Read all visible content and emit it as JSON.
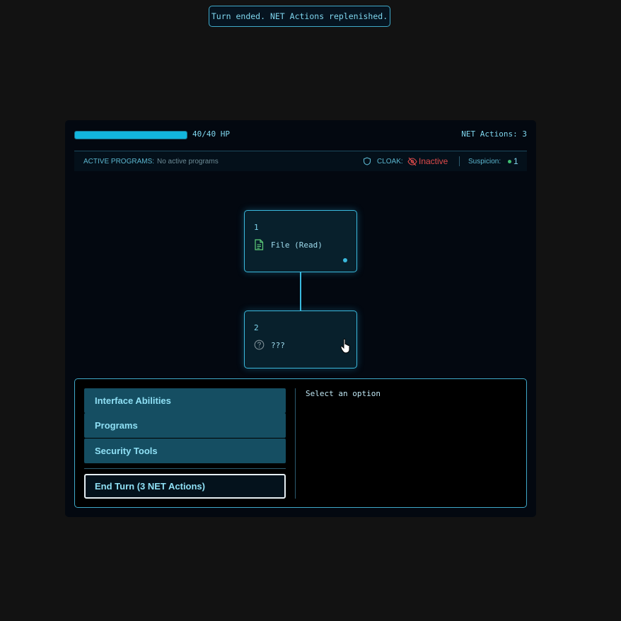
{
  "notification": {
    "text": "Turn ended. NET Actions replenished."
  },
  "header": {
    "hp": {
      "current": 40,
      "max": 40,
      "text": "40/40 HP",
      "fill_fraction": 1.0
    },
    "net_actions": "NET Actions: 3"
  },
  "status": {
    "active_programs_label": "ACTIVE PROGRAMS:",
    "active_programs_value": "No active programs",
    "cloak_label": "CLOAK:",
    "cloak_value": "Inactive",
    "suspicion_label": "Suspicion:",
    "suspicion_value": "1"
  },
  "nodes": [
    {
      "number": "1",
      "label": "File (Read)",
      "icon": "file-icon"
    },
    {
      "number": "2",
      "label": "???",
      "icon": "question-icon"
    }
  ],
  "menu": {
    "items": [
      "Interface Abilities",
      "Programs",
      "Security Tools"
    ],
    "end_turn": "End Turn (3 NET Actions)"
  },
  "detail": {
    "text": "Select an option"
  },
  "colors": {
    "accent": "#3ab9dd",
    "hp_fill": "#12b6de",
    "danger": "#e04b4b",
    "suspicion_dot": "#3fbf72",
    "button_bg": "#154e62"
  }
}
